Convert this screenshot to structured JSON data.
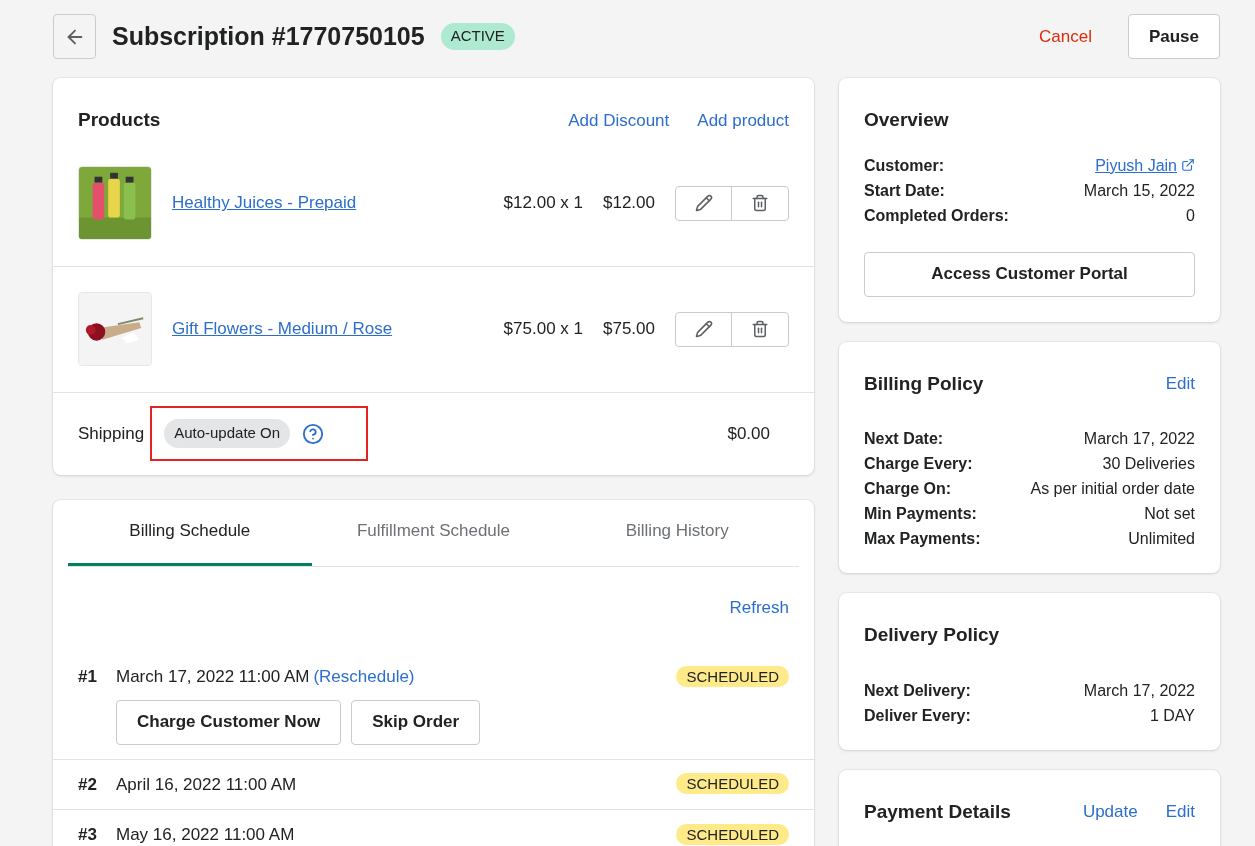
{
  "header": {
    "title": "Subscription #1770750105",
    "status": "ACTIVE",
    "actions": [
      {
        "label": "Cancel",
        "kind": "danger"
      },
      {
        "label": "Pause",
        "kind": "outline"
      }
    ]
  },
  "products": {
    "title": "Products",
    "links": [
      "Add Discount",
      "Add product"
    ],
    "items": [
      {
        "name": "Healthy Juices - Prepaid",
        "unit": "$12.00 x 1",
        "total": "$12.00",
        "kind": "juice"
      },
      {
        "name": "Gift Flowers - Medium / Rose",
        "unit": "$75.00 x 1",
        "total": "$75.00",
        "kind": "flowers"
      }
    ],
    "shipping": {
      "label": "Shipping",
      "tag": "Auto-update On",
      "amount": "$0.00",
      "highlighted": true
    }
  },
  "schedule": {
    "tabs": [
      {
        "label": "Billing Schedule",
        "selected": true
      },
      {
        "label": "Fulfillment Schedule",
        "selected": false
      },
      {
        "label": "Billing History",
        "selected": false
      }
    ],
    "refresh": "Refresh",
    "rows": [
      {
        "number": "#1",
        "date": "March 17, 2022 11:00 AM",
        "link": "(Reschedule)",
        "status": "SCHEDULED",
        "buttons": [
          "Charge Customer Now",
          "Skip Order"
        ]
      },
      {
        "number": "#2",
        "date": "April 16, 2022 11:00 AM",
        "status": "SCHEDULED"
      },
      {
        "number": "#3",
        "date": "May 16, 2022 11:00 AM",
        "status": "SCHEDULED"
      }
    ]
  },
  "overview": {
    "title": "Overview",
    "fields": [
      {
        "label": "Customer:",
        "value": "Piyush Jain",
        "kind": "link"
      },
      {
        "label": "Start Date:",
        "value": "March 15, 2022",
        "kind": "text"
      },
      {
        "label": "Completed Orders:",
        "value": "0",
        "kind": "text"
      }
    ],
    "button": "Access Customer Portal"
  },
  "billing_policy": {
    "title": "Billing Policy",
    "links": [
      "Edit"
    ],
    "fields": [
      {
        "label": "Next Date:",
        "value": "March 17, 2022"
      },
      {
        "label": "Charge Every:",
        "value": "30 Deliveries"
      },
      {
        "label": "Charge On:",
        "value": "As per initial order date"
      },
      {
        "label": "Min Payments:",
        "value": "Not set"
      },
      {
        "label": "Max Payments:",
        "value": "Unlimited"
      }
    ]
  },
  "delivery_policy": {
    "title": "Delivery Policy",
    "fields": [
      {
        "label": "Next Delivery:",
        "value": "March 17, 2022"
      },
      {
        "label": "Deliver Every:",
        "value": "1 DAY"
      }
    ]
  },
  "payment_details": {
    "title": "Payment Details",
    "links": [
      "Update",
      "Edit"
    ]
  }
}
